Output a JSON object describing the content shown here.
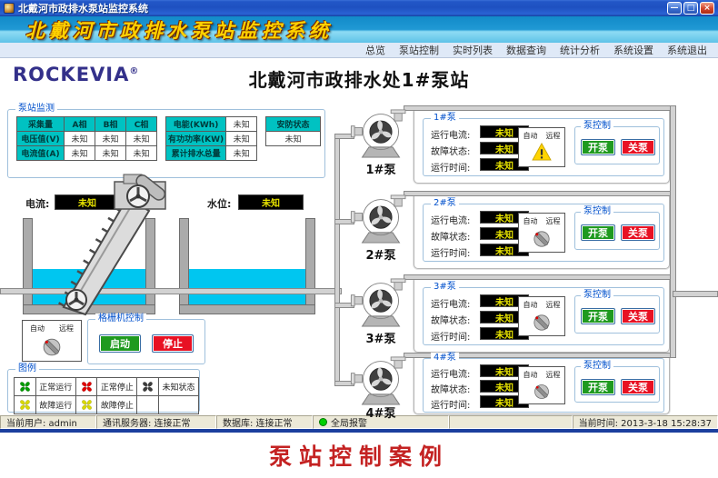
{
  "window": {
    "title": "北戴河市政排水泵站监控系统",
    "min_glyph": "—",
    "max_glyph": "□",
    "close_glyph": "×"
  },
  "banner": {
    "title": "北戴河市政排水泵站监控系统"
  },
  "menu": {
    "items": [
      "总览",
      "泵站控制",
      "实时列表",
      "数据查询",
      "统计分析",
      "系统设置",
      "系统退出"
    ]
  },
  "header": {
    "logo": "ROCKEVIA",
    "registered": "®",
    "station_title": "北戴河市政排水处1#泵站"
  },
  "monitor": {
    "group_title": "泵站监测",
    "phase_table": {
      "headers": [
        "采集量",
        "A相",
        "B相",
        "C相"
      ],
      "rows": [
        {
          "label": "电压值(V)",
          "v1": "未知",
          "v2": "未知",
          "v3": "未知"
        },
        {
          "label": "电流值(A)",
          "v1": "未知",
          "v2": "未知",
          "v3": "未知"
        }
      ]
    },
    "energy_table": {
      "rows": [
        {
          "label": "电能(KWh)",
          "value": "未知"
        },
        {
          "label": "有功功率(KW)",
          "value": "未知"
        },
        {
          "label": "累计排水总量",
          "value": "未知"
        }
      ]
    },
    "security": {
      "header": "安防状态",
      "value": "未知"
    }
  },
  "scene": {
    "current_label": "电流:",
    "current_value": "未知",
    "water_level_label": "水位:",
    "water_level_value": "未知"
  },
  "screen_machine": {
    "mode_auto": "自动",
    "mode_remote": "远程",
    "group_title": "格栅机控制",
    "start_label": "启动",
    "stop_label": "停止"
  },
  "legend": {
    "group_title": "图例",
    "items": [
      {
        "label": "正常运行",
        "color": "#009a00"
      },
      {
        "label": "正常停止",
        "color": "#e00000"
      },
      {
        "label": "未知状态",
        "color": "#3c3c3c"
      },
      {
        "label": "故障运行",
        "color": "#d8d800"
      },
      {
        "label": "故障停止",
        "color": "#d8d800"
      }
    ]
  },
  "pump_common": {
    "current_label": "运行电流:",
    "fault_label": "故障状态:",
    "time_label": "运行时间:",
    "mode_auto": "自动",
    "mode_remote": "远程",
    "control_title": "泵控制",
    "start_label": "开泵",
    "stop_label": "关泵"
  },
  "pumps": [
    {
      "name": "1#泵",
      "current": "未知",
      "fault": "未知",
      "time": "未知"
    },
    {
      "name": "2#泵",
      "current": "未知",
      "fault": "未知",
      "time": "未知"
    },
    {
      "name": "3#泵",
      "current": "未知",
      "fault": "未知",
      "time": "未知"
    },
    {
      "name": "4#泵",
      "current": "未知",
      "fault": "未知",
      "time": "未知"
    }
  ],
  "statusbar": {
    "user": "当前用户: admin",
    "comm_server": "通讯服务器: 连接正常",
    "database": "数据库: 连接正常",
    "global_alarm": "全局报警",
    "time": "当前时间: 2013-3-18 15:28:37"
  },
  "caption": "泵站控制案例",
  "colors": {
    "header_teal": "#00c2c2",
    "value_bg": "#000000",
    "value_text": "#e8e400",
    "water": "#00c6f0",
    "start_green": "#1f9a1f",
    "stop_red": "#e81123",
    "alarm_green": "#00d000",
    "caption_red": "#c42222",
    "titlebar_blue": "#1e50c0"
  }
}
